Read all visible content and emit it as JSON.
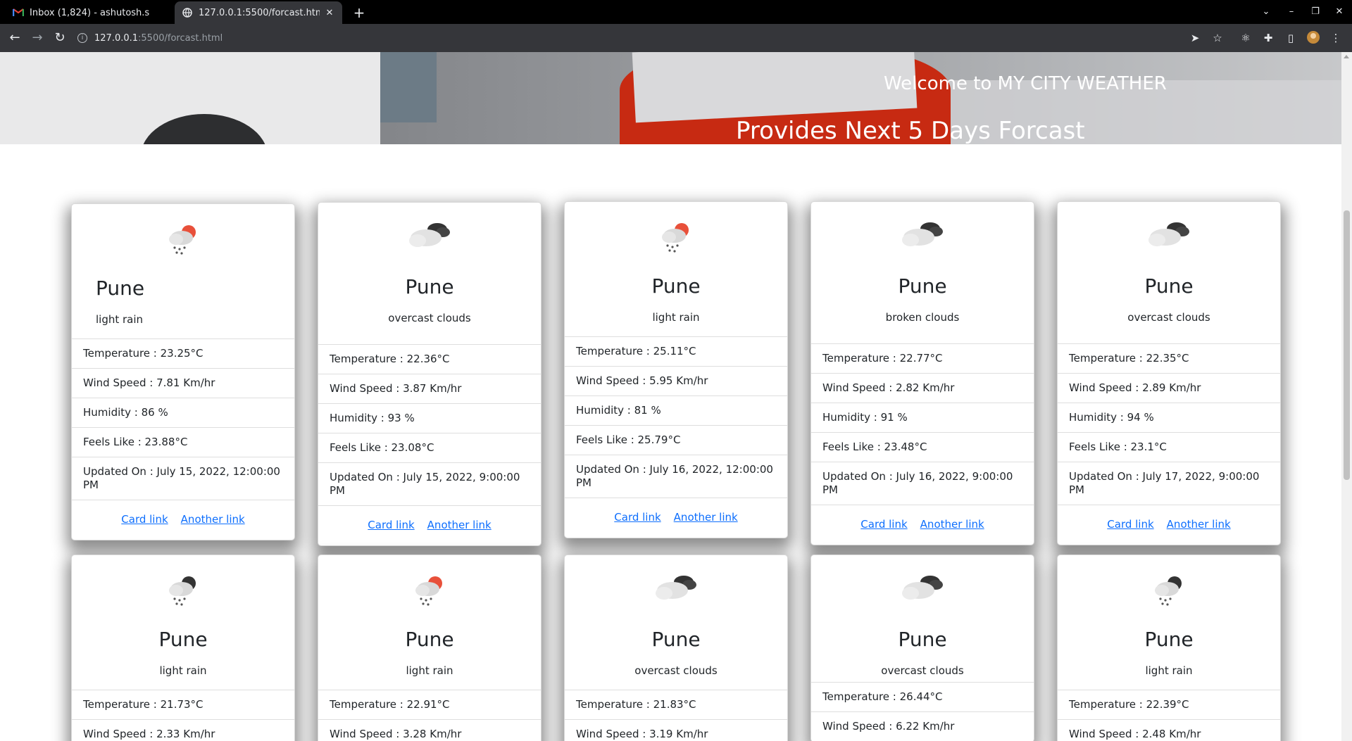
{
  "browser": {
    "tabs": [
      {
        "title": "Inbox (1,824) - ashutosh.s",
        "favicon": "gmail-icon",
        "active": false
      },
      {
        "title": "127.0.0.1:5500/forcast.htm",
        "favicon": "globe-icon",
        "active": true
      }
    ],
    "url_host": "127.0.0.1",
    "url_path": ":5500/forcast.html"
  },
  "hero": {
    "welcome": "Welcome to MY CITY WEATHER",
    "subtitle": "Provides Next 5 Days Forcast"
  },
  "labels": {
    "temperature": "Temperature : ",
    "wind": "Wind Speed : ",
    "humidity": "Humidity : ",
    "feels": "Feels Like : ",
    "updated": "Updated On : ",
    "card_link": "Card link",
    "another_link": "Another link"
  },
  "cards": [
    {
      "city": "Pune",
      "description": "light rain",
      "icon": "rain-sun-icon",
      "temperature": "Temperature : 23.25°C",
      "wind": "Wind Speed : 7.81 Km/hr",
      "humidity": "Humidity : 86 %",
      "feels": "Feels Like : 23.88°C",
      "updated": "Updated On : July 15, 2022, 12:00:00 PM",
      "card_link": "Card link",
      "another_link": "Another link"
    },
    {
      "city": "Pune",
      "description": "overcast clouds",
      "icon": "overcast-clouds-icon",
      "temperature": "Temperature : 22.36°C",
      "wind": "Wind Speed : 3.87 Km/hr",
      "humidity": "Humidity : 93 %",
      "feels": "Feels Like : 23.08°C",
      "updated": "Updated On : July 15, 2022, 9:00:00 PM",
      "card_link": "Card link",
      "another_link": "Another link"
    },
    {
      "city": "Pune",
      "description": "light rain",
      "icon": "rain-sun-icon",
      "temperature": "Temperature : 25.11°C",
      "wind": "Wind Speed : 5.95 Km/hr",
      "humidity": "Humidity : 81 %",
      "feels": "Feels Like : 25.79°C",
      "updated": "Updated On : July 16, 2022, 12:00:00 PM",
      "card_link": "Card link",
      "another_link": "Another link"
    },
    {
      "city": "Pune",
      "description": "broken clouds",
      "icon": "broken-clouds-icon",
      "temperature": "Temperature : 22.77°C",
      "wind": "Wind Speed : 2.82 Km/hr",
      "humidity": "Humidity : 91 %",
      "feels": "Feels Like : 23.48°C",
      "updated": "Updated On : July 16, 2022, 9:00:00 PM",
      "card_link": "Card link",
      "another_link": "Another link"
    },
    {
      "city": "Pune",
      "description": "overcast clouds",
      "icon": "overcast-clouds-icon",
      "temperature": "Temperature : 22.35°C",
      "wind": "Wind Speed : 2.89 Km/hr",
      "humidity": "Humidity : 94 %",
      "feels": "Feels Like : 23.1°C",
      "updated": "Updated On : July 17, 2022, 9:00:00 PM",
      "card_link": "Card link",
      "another_link": "Another link"
    },
    {
      "city": "Pune",
      "description": "light rain",
      "icon": "rain-night-icon",
      "temperature": "Temperature : 21.73°C",
      "wind": "Wind Speed : 2.33 Km/hr"
    },
    {
      "city": "Pune",
      "description": "light rain",
      "icon": "rain-sun-icon",
      "temperature": "Temperature : 22.91°C",
      "wind": "Wind Speed : 3.28 Km/hr"
    },
    {
      "city": "Pune",
      "description": "overcast clouds",
      "icon": "overcast-clouds-icon",
      "temperature": "Temperature : 21.83°C",
      "wind": "Wind Speed : 3.19 Km/hr"
    },
    {
      "city": "Pune",
      "description": "overcast clouds",
      "icon": "overcast-clouds-icon",
      "temperature": "Temperature : 26.44°C",
      "wind": "Wind Speed : 6.22 Km/hr"
    },
    {
      "city": "Pune",
      "description": "light rain",
      "icon": "rain-night-icon",
      "temperature": "Temperature : 22.39°C",
      "wind": "Wind Speed : 2.48 Km/hr"
    }
  ]
}
